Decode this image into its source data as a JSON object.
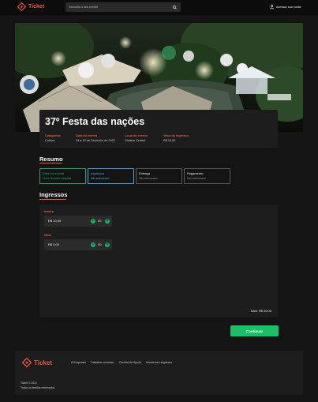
{
  "header": {
    "brand": "Ticket",
    "search_placeholder": "Encontre o seu evento",
    "login_label": "Acessar sua conta"
  },
  "event": {
    "title": "37º Festa das nações",
    "info": [
      {
        "label": "Categorias",
        "value": "Cultura"
      },
      {
        "label": "Data do evento",
        "value": "15 a 19 de Fevereiro de 2022"
      },
      {
        "label": "Local do evento",
        "value": "Ginásio Central"
      },
      {
        "label": "Valor do ingresso",
        "value": "R$ 10,00"
      }
    ]
  },
  "summary": {
    "title": "Resumo",
    "steps": [
      {
        "title": "Data do evento",
        "sub": "15 de Fevereiro completa",
        "state": "done"
      },
      {
        "title": "Ingressos",
        "sub": "Não selecionado",
        "state": "active"
      },
      {
        "title": "Entrega",
        "sub": "Não selecionado",
        "state": "pending"
      },
      {
        "title": "Pagamento",
        "sub": "Não selecionado",
        "state": "pending"
      }
    ]
  },
  "tickets": {
    "title": "Ingressos",
    "items": [
      {
        "name": "Inteira",
        "price": "R$ 10,00",
        "qty": "00"
      },
      {
        "name": "Meia",
        "price": "R$ 5,00",
        "qty": "00"
      }
    ],
    "total": "Total: R$ 00,00",
    "continue_label": "Continuar"
  },
  "footer": {
    "brand": "Ticket",
    "links": [
      "A Empresa",
      "Trabalhe conosco",
      "Central de Ajuda",
      "Venda seu ingresso"
    ],
    "copyright_1": "Ticket © 2021",
    "copyright_2": "Todos os direitos reservados."
  },
  "colors": {
    "accent": "#e8563c",
    "success": "#17c267",
    "info": "#4aa3df",
    "background": "#141414",
    "panel": "#1d1d1d"
  },
  "icons": [
    "ticket-logo-icon",
    "search-icon",
    "user-icon",
    "minus-icon",
    "plus-icon"
  ]
}
